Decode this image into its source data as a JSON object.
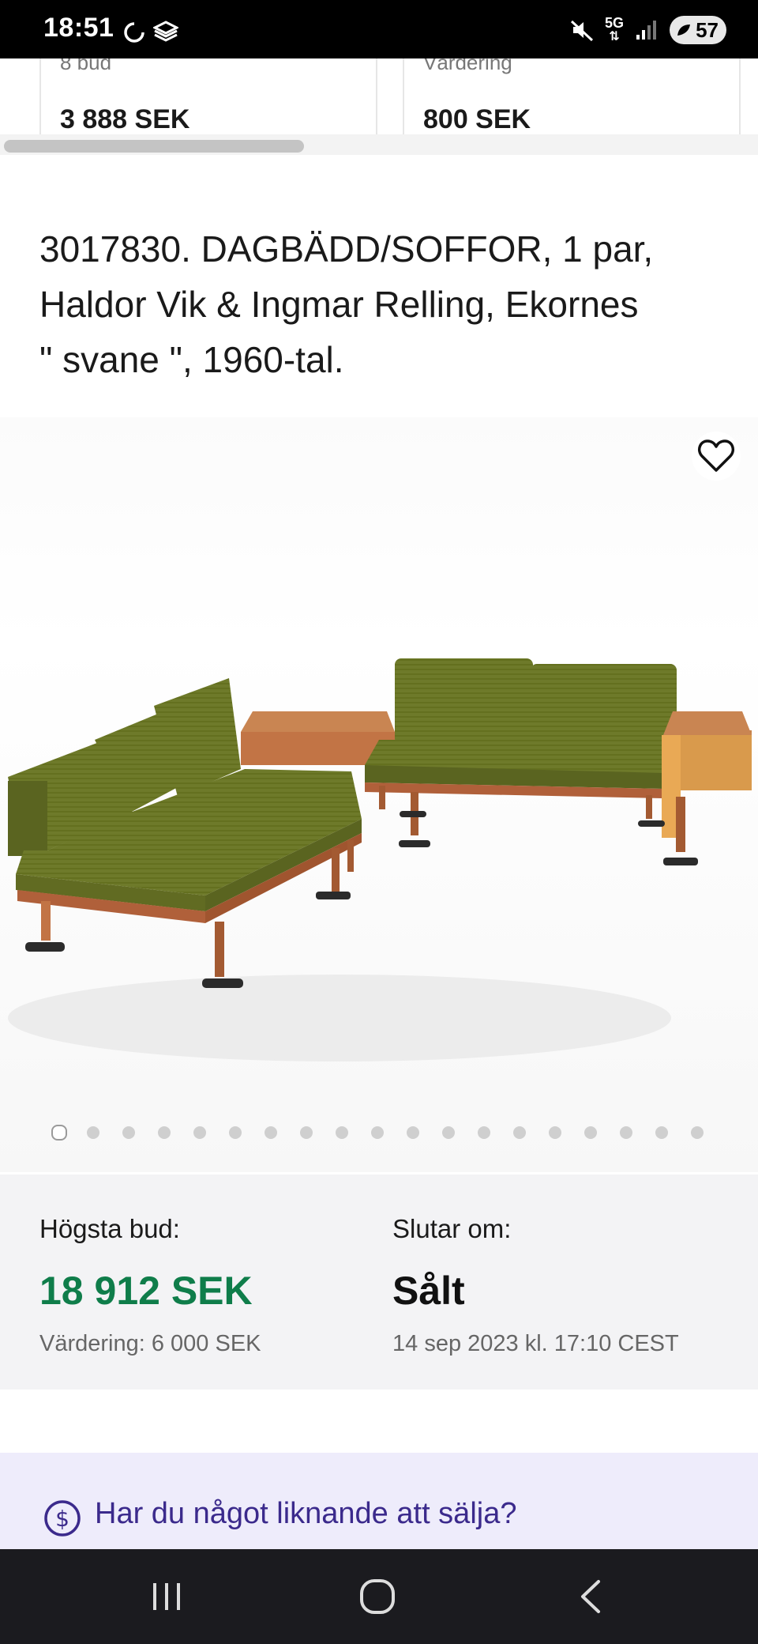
{
  "status_bar": {
    "time": "18:51",
    "network": "5G",
    "battery": "57",
    "icons": [
      "sync-icon",
      "cube-icon",
      "mute-icon",
      "5g-icon",
      "signal-icon",
      "battery-icon"
    ]
  },
  "related_cards": [
    {
      "label_partial": "8 bud",
      "price": "3 888 SEK"
    },
    {
      "label_partial": "Värdering",
      "price": "800 SEK"
    }
  ],
  "lot": {
    "title_lines": [
      "3017830. DAGBÄDD/SOFFOR, 1 par,",
      "Haldor Vik & Ingmar Relling, Ekornes",
      "\" svane \", 1960-tal."
    ],
    "favorite_icon": "heart-outline-icon",
    "image_count": 19,
    "active_image_index": 0
  },
  "bid": {
    "highest_label": "Högsta bud:",
    "highest_value": "18 912 SEK",
    "estimate": "Värdering: 6 000 SEK",
    "ends_label": "Slutar om:",
    "ends_value": "Sålt",
    "ends_date": "14 sep 2023 kl. 17:10 CEST"
  },
  "sell_banner": {
    "text": "Har du något liknande att sälja?",
    "icon": "dollar-circle-icon"
  },
  "navigation": {
    "buttons": [
      "recent-apps-icon",
      "home-icon",
      "back-icon"
    ]
  },
  "colors": {
    "price_green": "#0f7d4a",
    "banner_bg": "#eeecfb",
    "banner_text": "#3b2a8c",
    "upholstery": "#6e7a2a",
    "teak": "#b0603a"
  }
}
